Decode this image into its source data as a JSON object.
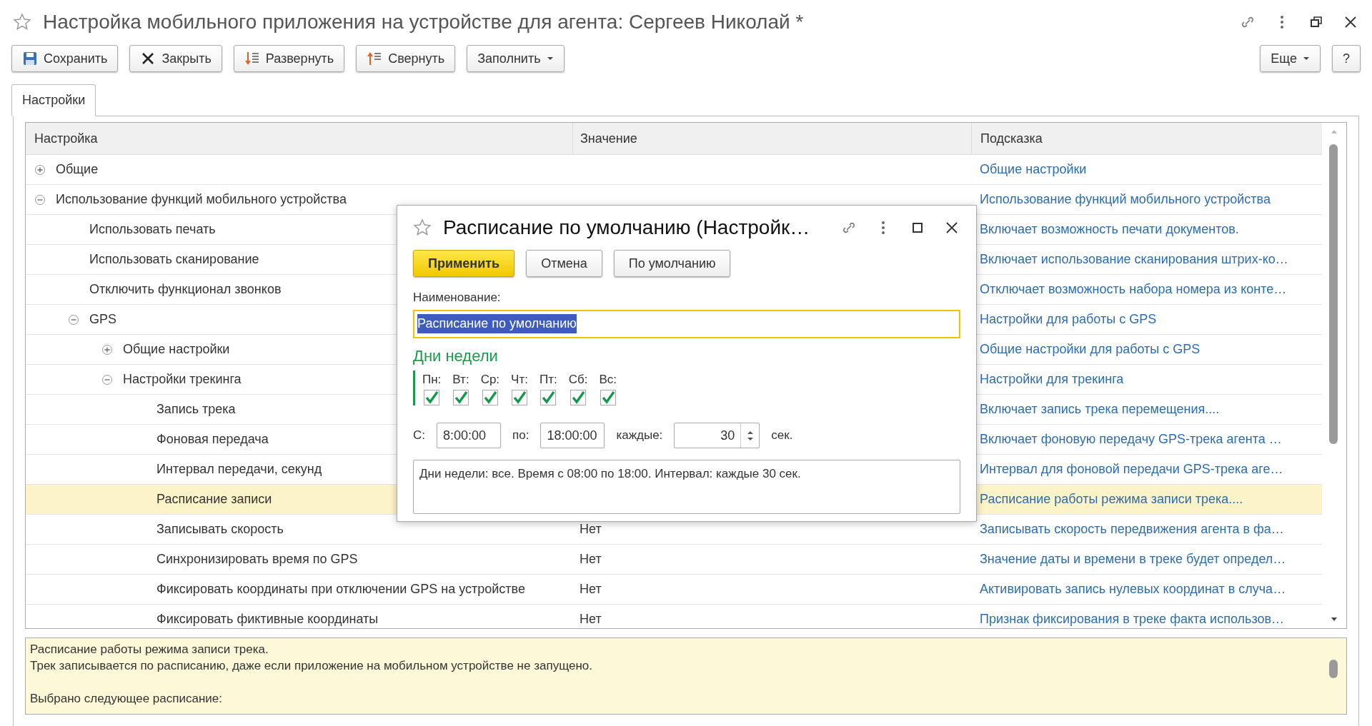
{
  "window": {
    "title": "Настройка мобильного приложения на устройстве для агента: Сергеев Николай *",
    "favorite": false
  },
  "toolbar": {
    "buttons": [
      {
        "label": "Сохранить",
        "kind": "save"
      },
      {
        "label": "Закрыть",
        "kind": "close"
      },
      {
        "label": "Развернуть",
        "kind": "expand"
      },
      {
        "label": "Свернуть",
        "kind": "collapse"
      },
      {
        "label": "Заполнить",
        "kind": "menu"
      }
    ],
    "right_buttons": [
      {
        "label": "Еще",
        "kind": "menu"
      },
      {
        "label": "?",
        "kind": "plain"
      }
    ]
  },
  "tabs": [
    {
      "label": "Настройки",
      "selected": true
    }
  ],
  "table": {
    "columns": [
      "Настройка",
      "Значение",
      "Подсказка"
    ],
    "rows": [
      {
        "name": "Общие",
        "hint": "Общие настройки",
        "expanded": false,
        "selected": false
      },
      {
        "name": "Использование функций мобильного устройства",
        "hint": "Использование функций мобильного устройства",
        "expanded": true,
        "selected": false,
        "children": [
          {
            "name": "Использовать печать",
            "hint": "Включает возможность печати документов.",
            "selected": false
          },
          {
            "name": "Использовать сканирование",
            "hint": "Включает использование сканирования штрих-ко…",
            "selected": false
          },
          {
            "name": "Отключить функционал звонков",
            "hint": "Отключает возможность набора номера из конте…",
            "selected": false
          },
          {
            "name": "GPS",
            "hint": "Настройки для работы с GPS",
            "expanded": true,
            "selected": false,
            "children": [
              {
                "name": "Общие настройки",
                "hint": "Общие настройки для работы с GPS",
                "expanded": false,
                "selected": false
              },
              {
                "name": "Настройки трекинга",
                "hint": "Настройки для трекинга",
                "expanded": true,
                "selected": false,
                "children": [
                  {
                    "name": "Запись трека",
                    "hint": "Включает запись трека перемещения....",
                    "selected": false
                  },
                  {
                    "name": "Фоновая передача",
                    "hint": "Включает фоновую передачу GPS-трека агента …",
                    "selected": false
                  },
                  {
                    "name": "Интервал передачи, секунд",
                    "hint": "Интервал для фоновой передачи GPS-трека аге…",
                    "selected": false
                  },
                  {
                    "name": "Расписание записи",
                    "hint": "Расписание работы режима записи трека....",
                    "selected": true
                  },
                  {
                    "name": "Записывать скорость",
                    "value": "Нет",
                    "hint": "Записывать скорость передвижения агента в фа…",
                    "selected": false
                  },
                  {
                    "name": "Синхронизировать время по GPS",
                    "value": "Нет",
                    "hint": "Значение даты и времени в треке будет определ…",
                    "selected": false
                  },
                  {
                    "name": "Фиксировать координаты при отключении GPS на устройстве",
                    "value": "Нет",
                    "hint": "Активировать запись нулевых координат в случа…",
                    "selected": false
                  },
                  {
                    "name": "Фиксировать фиктивные координаты",
                    "value": "Нет",
                    "hint": "Признак фиксирования в треке факта использов…",
                    "selected": false
                  }
                ]
              }
            ]
          }
        ]
      }
    ]
  },
  "dialog": {
    "title": "Расписание по умолчанию (Настройк…",
    "favorite": false,
    "buttons": [
      {
        "label": "Применить",
        "kind": "default"
      },
      {
        "label": "Отмена",
        "kind": "plain"
      },
      {
        "label": "По умолчанию",
        "kind": "plain"
      }
    ],
    "name_label": "Наименование:",
    "name_value": "Расписание по умолчанию",
    "name_selected": true,
    "days_title": "Дни недели",
    "days": [
      {
        "label": "Пн:",
        "checked": true
      },
      {
        "label": "Вт:",
        "checked": true
      },
      {
        "label": "Ср:",
        "checked": true
      },
      {
        "label": "Чт:",
        "checked": true
      },
      {
        "label": "Пт:",
        "checked": true
      },
      {
        "label": "Сб:",
        "checked": true
      },
      {
        "label": "Вс:",
        "checked": true
      }
    ],
    "from_label": "С:",
    "from_value": "8:00:00",
    "to_label": "по:",
    "to_value": "18:00:00",
    "every_label": "каждые:",
    "every_value": "30",
    "unit": "сек.",
    "summary": "Дни недели: все. Время с 08:00 по 18:00. Интервал: каждые 30 сек."
  },
  "details_panel": {
    "paragraphs": [
      [
        "Расписание работы режима записи трека.",
        "Трек записывается по расписанию, даже если приложение на мобильном устройстве не запущено."
      ],
      [
        "Выбрано следующее расписание:"
      ]
    ]
  }
}
